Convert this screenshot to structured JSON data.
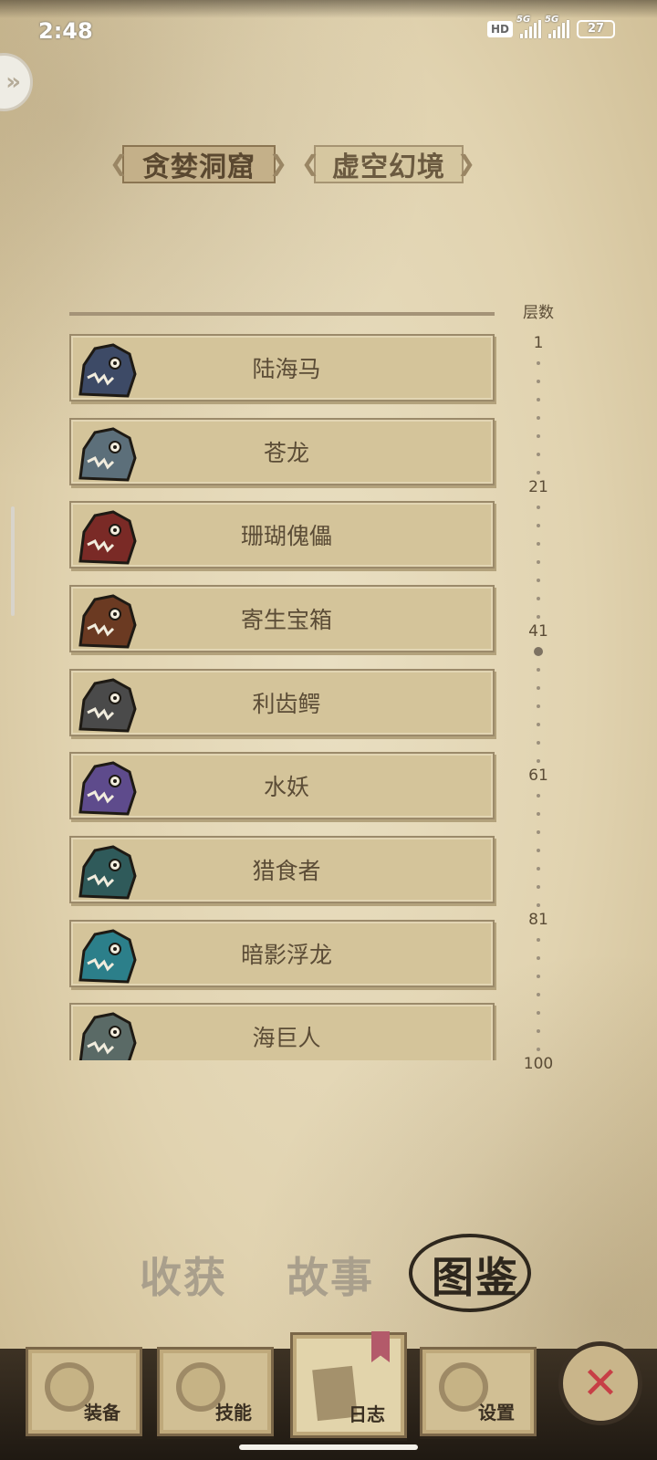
{
  "status_bar": {
    "time": "2:48",
    "hd": "HD",
    "net1": "5G",
    "net2": "5G",
    "battery": "27"
  },
  "region_tabs": [
    {
      "label": "贪婪洞窟",
      "active": true
    },
    {
      "label": "虚空幻境",
      "active": false
    }
  ],
  "monsters": [
    {
      "name": "陆海马",
      "icon": "land-seahorse-icon",
      "color": "#3d4a66"
    },
    {
      "name": "苍龙",
      "icon": "azure-dragon-icon",
      "color": "#5c6f7a"
    },
    {
      "name": "珊瑚傀儡",
      "icon": "coral-golem-icon",
      "color": "#7a2a26"
    },
    {
      "name": "寄生宝箱",
      "icon": "parasite-chest-icon",
      "color": "#6b3a22"
    },
    {
      "name": "利齿鳄",
      "icon": "sharp-tooth-croc-icon",
      "color": "#4a4a4a"
    },
    {
      "name": "水妖",
      "icon": "water-demon-icon",
      "color": "#5e4b8c"
    },
    {
      "name": "猎食者",
      "icon": "predator-icon",
      "color": "#2f5a5a"
    },
    {
      "name": "暗影浮龙",
      "icon": "shadow-dragon-icon",
      "color": "#2c7f8a"
    },
    {
      "name": "海巨人",
      "icon": "sea-giant-icon",
      "color": "#5a6a66"
    }
  ],
  "scale": {
    "title": "层数",
    "labels": [
      "1",
      "21",
      "41",
      "61",
      "81",
      "100"
    ]
  },
  "bottom_tabs": [
    {
      "label": "收获",
      "active": false
    },
    {
      "label": "故事",
      "active": false
    },
    {
      "label": "图鉴",
      "active": true
    }
  ],
  "nav": [
    {
      "label": "装备",
      "icon": "equipment-icon",
      "active": false
    },
    {
      "label": "技能",
      "icon": "skill-icon",
      "active": false
    },
    {
      "label": "日志",
      "icon": "journal-icon",
      "active": true
    },
    {
      "label": "设置",
      "icon": "settings-gear-icon",
      "active": false
    }
  ],
  "close_symbol": "✕"
}
